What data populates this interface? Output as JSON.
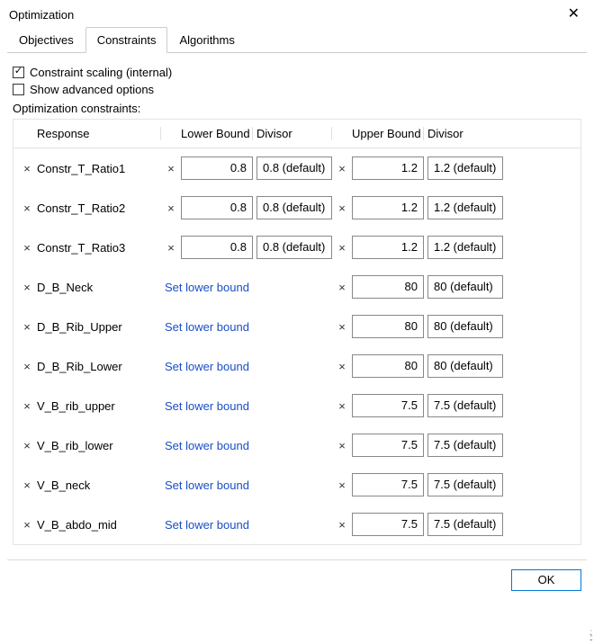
{
  "window": {
    "title": "Optimization",
    "close": "✕"
  },
  "tabs": {
    "items": [
      "Objectives",
      "Constraints",
      "Algorithms"
    ],
    "active": 1
  },
  "options": {
    "scaling": {
      "label": "Constraint scaling (internal)",
      "checked": true
    },
    "advanced": {
      "label": "Show advanced options",
      "checked": false
    }
  },
  "section_label": "Optimization constraints:",
  "headers": {
    "response": "Response",
    "lower": "Lower Bound",
    "divisor1": "Divisor",
    "upper": "Upper Bound",
    "divisor2": "Divisor"
  },
  "set_lower_label": "Set lower bound",
  "rows": [
    {
      "response": "Constr_T_Ratio1",
      "lower": "0.8",
      "lower_div": "0.8 (default)",
      "upper": "1.2",
      "upper_div": "1.2 (default)"
    },
    {
      "response": "Constr_T_Ratio2",
      "lower": "0.8",
      "lower_div": "0.8 (default)",
      "upper": "1.2",
      "upper_div": "1.2 (default)"
    },
    {
      "response": "Constr_T_Ratio3",
      "lower": "0.8",
      "lower_div": "0.8 (default)",
      "upper": "1.2",
      "upper_div": "1.2 (default)"
    },
    {
      "response": "D_B_Neck",
      "lower": null,
      "lower_div": null,
      "upper": "80",
      "upper_div": "80 (default)"
    },
    {
      "response": "D_B_Rib_Upper",
      "lower": null,
      "lower_div": null,
      "upper": "80",
      "upper_div": "80 (default)"
    },
    {
      "response": "D_B_Rib_Lower",
      "lower": null,
      "lower_div": null,
      "upper": "80",
      "upper_div": "80 (default)"
    },
    {
      "response": "V_B_rib_upper",
      "lower": null,
      "lower_div": null,
      "upper": "7.5",
      "upper_div": "7.5 (default)"
    },
    {
      "response": "V_B_rib_lower",
      "lower": null,
      "lower_div": null,
      "upper": "7.5",
      "upper_div": "7.5 (default)"
    },
    {
      "response": "V_B_neck",
      "lower": null,
      "lower_div": null,
      "upper": "7.5",
      "upper_div": "7.5 (default)"
    },
    {
      "response": "V_B_abdo_mid",
      "lower": null,
      "lower_div": null,
      "upper": "7.5",
      "upper_div": "7.5 (default)"
    }
  ],
  "footer": {
    "ok": "OK"
  }
}
